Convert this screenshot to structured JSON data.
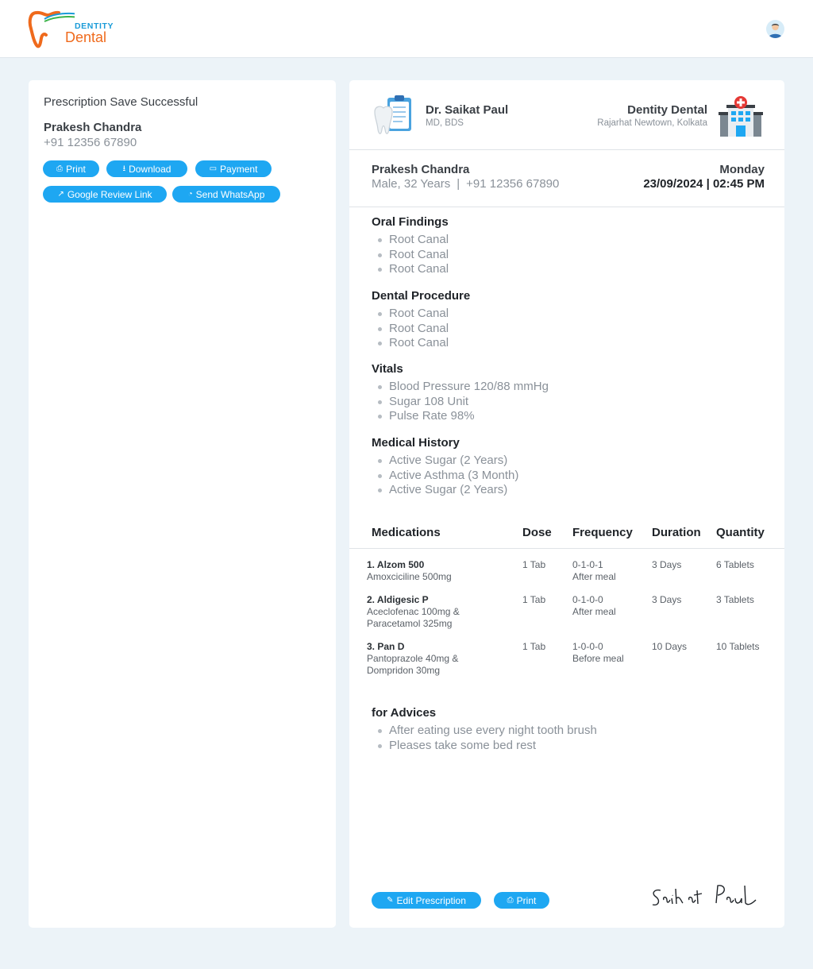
{
  "header": {
    "logo_top": "DENTITY",
    "logo_main": "Dental",
    "avatar_icon": "user-avatar-icon"
  },
  "colors": {
    "accent": "#1ea7f2",
    "brand_orange": "#ef6a1c",
    "brand_blue": "#1a9bd8",
    "background": "#ecf3f8"
  },
  "left": {
    "status": "Prescription Save Successful",
    "patient_name": "Prakesh Chandra",
    "patient_phone": "+91 12356 67890",
    "buttons": {
      "print": "Print",
      "download": "Download",
      "payment": "Payment",
      "google_review": "Google Review Link",
      "whatsapp": "Send WhatsApp"
    }
  },
  "prescription": {
    "doctor": {
      "name": "Dr. Saikat Paul",
      "degree": "MD, BDS"
    },
    "clinic": {
      "name": "Dentity Dental",
      "address": "Rajarhat Newtown, Kolkata"
    },
    "patient": {
      "name": "Prakesh Chandra",
      "gender_age": "Male, 32 Years",
      "phone": "+91 12356 67890",
      "day": "Monday",
      "date": "23/09/2024",
      "time": "02:45 PM"
    },
    "oral_findings": {
      "title": "Oral Findings",
      "items": [
        "Root Canal",
        "Root Canal",
        "Root Canal"
      ]
    },
    "dental_procedure": {
      "title": "Dental Procedure",
      "items": [
        "Root Canal",
        "Root Canal",
        "Root Canal"
      ]
    },
    "vitals": {
      "title": "Vitals",
      "items": [
        "Blood Pressure 120/88 mmHg",
        "Sugar 108 Unit",
        "Pulse Rate 98%"
      ]
    },
    "medical_history": {
      "title": "Medical History",
      "items": [
        "Active Sugar (2 Years)",
        "Active Asthma (3 Month)",
        "Active Sugar (2 Years)"
      ]
    },
    "medications": {
      "headers": {
        "name": "Medications",
        "dose": "Dose",
        "frequency": "Frequency",
        "duration": "Duration",
        "quantity": "Quantity"
      },
      "rows": [
        {
          "index": "1.",
          "name": "Alzom 500",
          "composition_1": "Amoxciciline 500mg",
          "composition_2": "",
          "dose": "1 Tab",
          "frequency": "0-1-0-1",
          "timing": "After meal",
          "duration": "3 Days",
          "quantity": "6 Tablets"
        },
        {
          "index": "2.",
          "name": "Aldigesic P",
          "composition_1": "Aceclofenac 100mg &",
          "composition_2": "Paracetamol 325mg",
          "dose": "1 Tab",
          "frequency": "0-1-0-0",
          "timing": "After meal",
          "duration": "3 Days",
          "quantity": "3 Tablets"
        },
        {
          "index": "3.",
          "name": "Pan D",
          "composition_1": "Pantoprazole 40mg &",
          "composition_2": "Dompridon 30mg",
          "dose": "1 Tab",
          "frequency": "1-0-0-0",
          "timing": "Before meal",
          "duration": "10 Days",
          "quantity": "10 Tablets"
        }
      ]
    },
    "advices": {
      "title": "for Advices",
      "items": [
        "After eating use every night tooth brush",
        "Pleases take some bed rest"
      ]
    },
    "buttons": {
      "edit": "Edit Prescription",
      "print": "Print"
    },
    "signature": "Saikat Paul"
  }
}
